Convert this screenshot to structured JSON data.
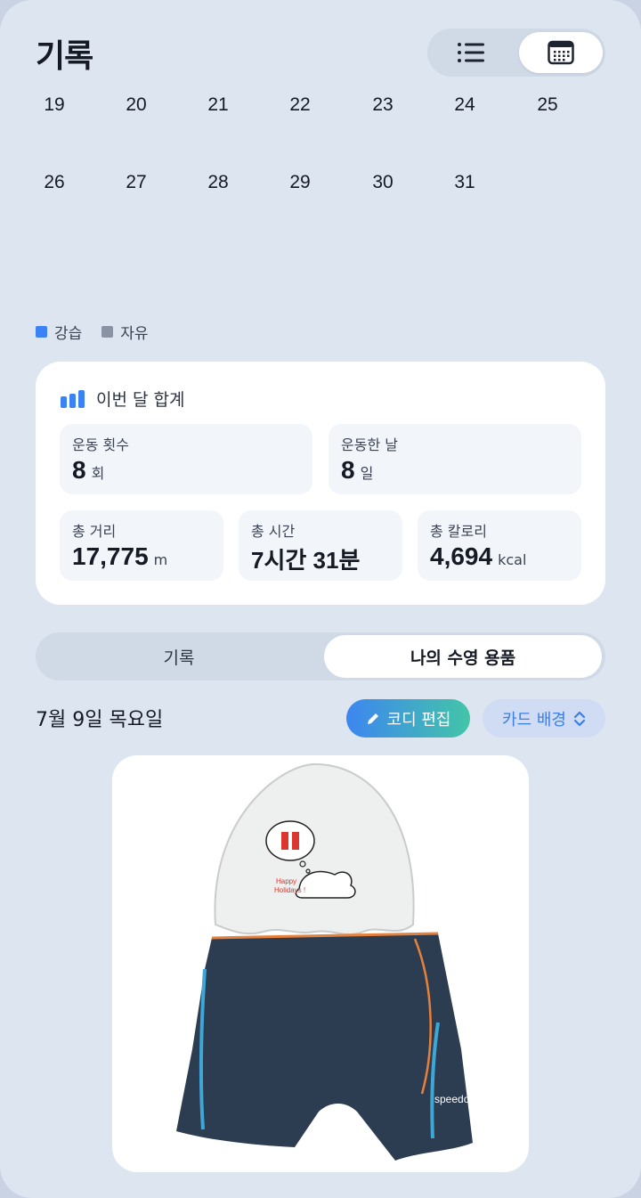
{
  "header": {
    "title": "기록"
  },
  "view_toggle": {
    "list_icon": "list-icon",
    "calendar_icon": "calendar-icon",
    "active": "calendar"
  },
  "calendar": {
    "weeks": [
      [
        "19",
        "20",
        "21",
        "22",
        "23",
        "24",
        "25"
      ],
      [
        "26",
        "27",
        "28",
        "29",
        "30",
        "31"
      ]
    ]
  },
  "legend": [
    {
      "label": "강습",
      "color": "#3b82f6"
    },
    {
      "label": "자유",
      "color": "#8a93a3"
    }
  ],
  "summary": {
    "title": "이번 달 합계",
    "icon": "bar-chart-icon",
    "sessions": {
      "label": "운동 횟수",
      "value": "8",
      "unit": "회"
    },
    "days": {
      "label": "운동한 날",
      "value": "8",
      "unit": "일"
    },
    "distance": {
      "label": "총 거리",
      "value": "17,775",
      "unit": "m"
    },
    "time": {
      "label": "총 시간",
      "value": "7시간 31분",
      "unit": ""
    },
    "calories": {
      "label": "총 칼로리",
      "value": "4,694",
      "unit": "kcal"
    }
  },
  "tabs": {
    "records": "기록",
    "gear": "나의 수영 용품",
    "active": "gear"
  },
  "gear_section": {
    "date": "7월 9일 목요일",
    "edit_button": "코디 편집",
    "background_button": "카드 배경",
    "cap_text": [
      "Happy",
      "Holidays !"
    ],
    "trunks_brand": "speedo"
  },
  "colors": {
    "accent_blue": "#3b82f6",
    "gradient_end": "#43c5a8",
    "background": "#dde5f1"
  }
}
